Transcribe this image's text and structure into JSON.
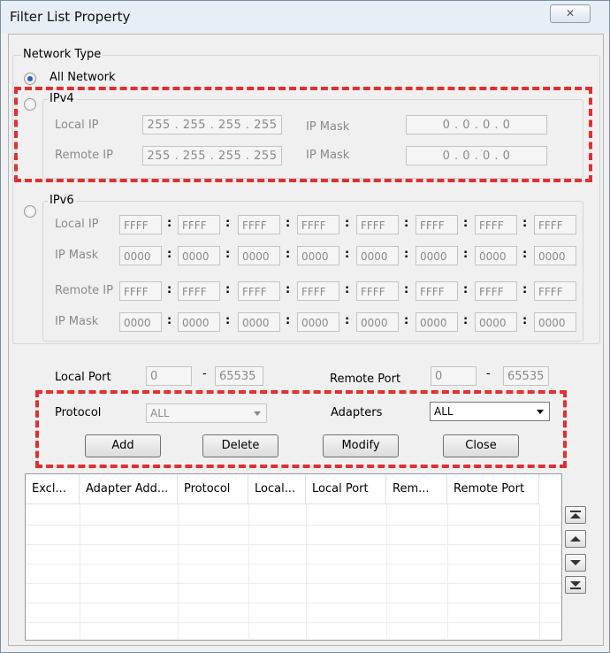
{
  "window": {
    "title": "Filter List Property",
    "close_glyph": "✕"
  },
  "network_type": {
    "label": "Network Type",
    "all_network": "All Network",
    "ipv4": {
      "label": "IPv4",
      "local_ip_label": "Local IP",
      "local_ip": "255 . 255 . 255 . 255",
      "ip_mask_label": "IP Mask",
      "local_mask": "0  .  0  .  0  .  0",
      "remote_ip_label": "Remote IP",
      "remote_ip": "255 . 255 . 255 . 255",
      "remote_mask": "0  .  0  .  0  .  0"
    },
    "ipv6": {
      "label": "IPv6",
      "rows": [
        {
          "label": "Local IP",
          "values": [
            "FFFF",
            "FFFF",
            "FFFF",
            "FFFF",
            "FFFF",
            "FFFF",
            "FFFF",
            "FFFF"
          ]
        },
        {
          "label": "IP Mask",
          "values": [
            "0000",
            "0000",
            "0000",
            "0000",
            "0000",
            "0000",
            "0000",
            "0000"
          ]
        },
        {
          "label": "Remote IP",
          "values": [
            "FFFF",
            "FFFF",
            "FFFF",
            "FFFF",
            "FFFF",
            "FFFF",
            "FFFF",
            "FFFF"
          ]
        },
        {
          "label": "IP Mask",
          "values": [
            "0000",
            "0000",
            "0000",
            "0000",
            "0000",
            "0000",
            "0000",
            "0000"
          ]
        }
      ]
    }
  },
  "ports": {
    "local_label": "Local Port",
    "local_from": "0",
    "local_to": "65535",
    "remote_label": "Remote Port",
    "remote_from": "0",
    "remote_to": "65535",
    "dash": "-"
  },
  "protocol": {
    "label": "Protocol",
    "value": "ALL"
  },
  "adapters": {
    "label": "Adapters",
    "value": "ALL"
  },
  "buttons": {
    "add": "Add",
    "delete": "Delete",
    "modify": "Modify",
    "close": "Close"
  },
  "table": {
    "columns": [
      "Excl...",
      "Adapter Add...",
      "Protocol",
      "Local...",
      "Local Port",
      "Rem...",
      "Remote Port"
    ]
  },
  "scroll_icons": [
    "move-top-icon",
    "move-up-icon",
    "move-down-icon",
    "move-bottom-icon"
  ],
  "colors": {
    "highlight_dash": "#e03030",
    "radio_selected": "#2b5fbf"
  }
}
